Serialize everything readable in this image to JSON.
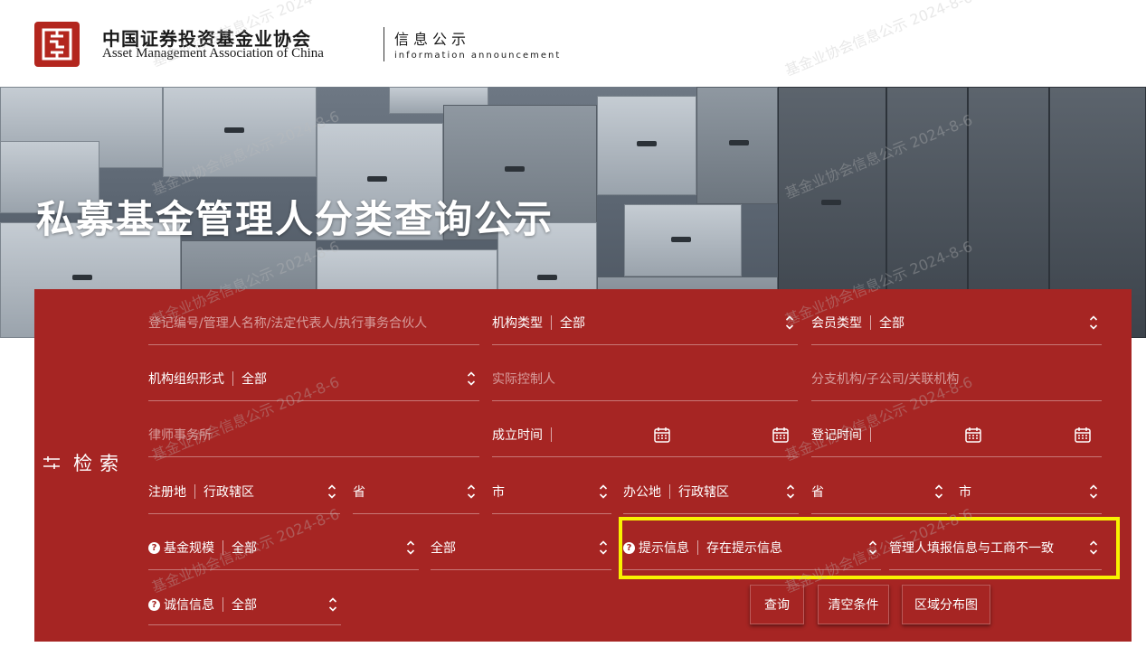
{
  "header": {
    "org_cn": "中国证券投资基金业协会",
    "org_en": "Asset Management Association of China",
    "info_cn": "信息公示",
    "info_en": "information announcement"
  },
  "banner": {
    "title": "私募基金管理人分类查询公示"
  },
  "search": {
    "side_label": "检索",
    "row1": {
      "keyword_placeholder": "登记编号/管理人名称/法定代表人/执行事务合伙人",
      "org_type_label": "机构类型",
      "org_type_value": "全部",
      "member_type_label": "会员类型",
      "member_type_value": "全部"
    },
    "row2": {
      "org_form_label": "机构组织形式",
      "org_form_value": "全部",
      "controller_placeholder": "实际控制人",
      "branch_placeholder": "分支机构/子公司/关联机构"
    },
    "row3": {
      "law_firm_placeholder": "律师事务所",
      "established_label": "成立时间",
      "registered_label": "登记时间"
    },
    "row4": {
      "reg_place_label": "注册地",
      "reg_place_value": "行政辖区",
      "reg_province": "省",
      "reg_city": "市",
      "office_label": "办公地",
      "office_value": "行政辖区",
      "office_province": "省",
      "office_city": "市"
    },
    "row5": {
      "fund_scale_label": "基金规模",
      "fund_scale_value": "全部",
      "fund_scale_value2": "全部",
      "hint_label": "提示信息",
      "hint_value": "存在提示信息",
      "hint_detail_value": "管理人填报信息与工商不一致"
    },
    "row6": {
      "integrity_label": "诚信信息",
      "integrity_value": "全部"
    },
    "buttons": {
      "query": "查询",
      "clear": "清空条件",
      "region_map": "区域分布图"
    }
  },
  "watermark": {
    "text": "基金业协会信息公示 2024-8-6"
  },
  "colors": {
    "panel": "#a62523",
    "highlight": "#f8f200",
    "brand_red": "#b3261e"
  }
}
